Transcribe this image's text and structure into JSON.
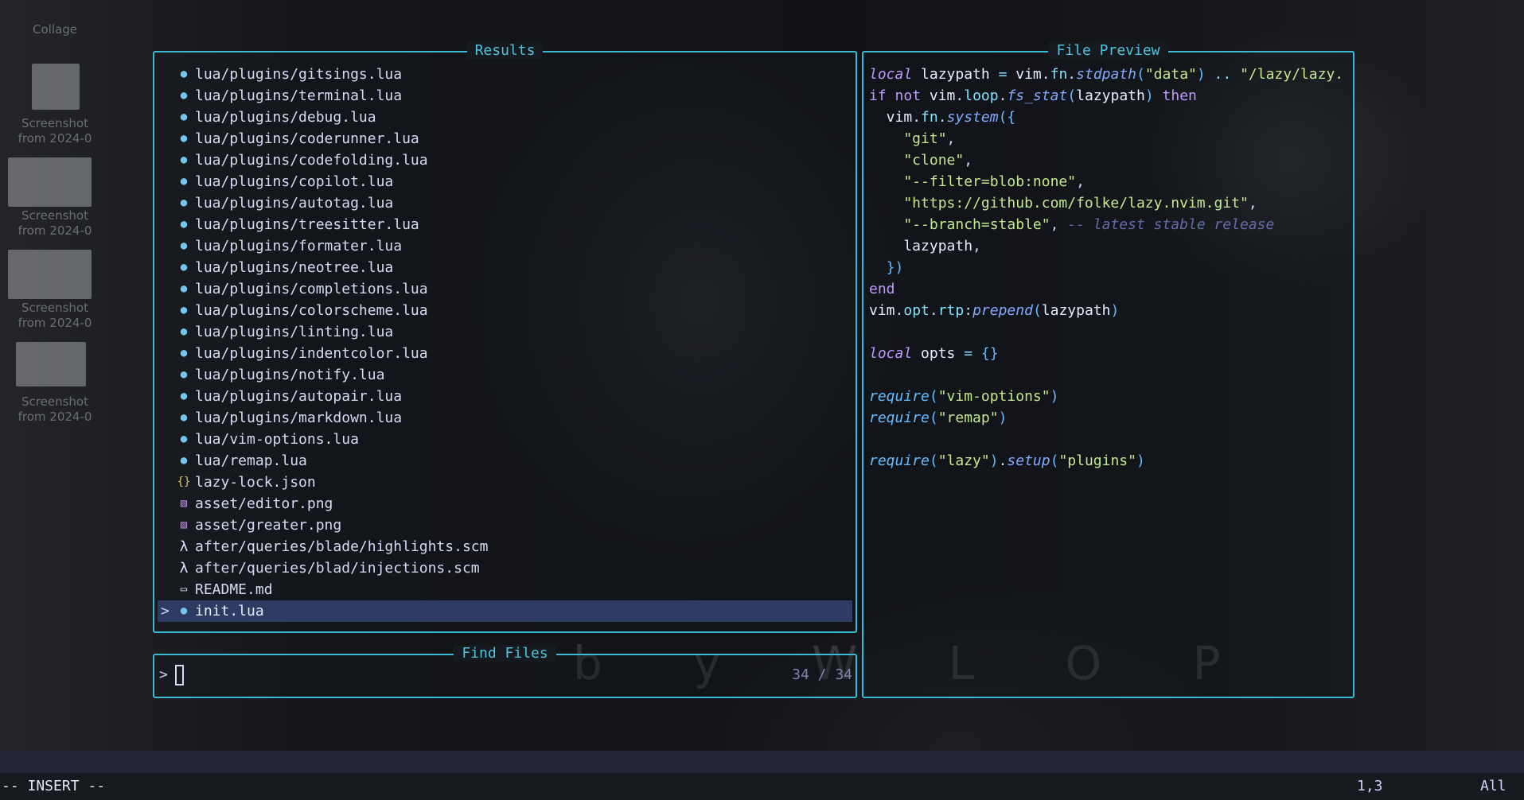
{
  "desktop": {
    "collage_label": "Collage",
    "screenshot_label_line1": "Screenshot",
    "screenshot_label_line2": "from 2024-0"
  },
  "results": {
    "title": "Results",
    "items": [
      {
        "icon": "lua-icon",
        "glyph": "●",
        "name": "lua/plugins/gitsings.lua"
      },
      {
        "icon": "lua-icon",
        "glyph": "●",
        "name": "lua/plugins/terminal.lua"
      },
      {
        "icon": "lua-icon",
        "glyph": "●",
        "name": "lua/plugins/debug.lua"
      },
      {
        "icon": "lua-icon",
        "glyph": "●",
        "name": "lua/plugins/coderunner.lua"
      },
      {
        "icon": "lua-icon",
        "glyph": "●",
        "name": "lua/plugins/codefolding.lua"
      },
      {
        "icon": "lua-icon",
        "glyph": "●",
        "name": "lua/plugins/copilot.lua"
      },
      {
        "icon": "lua-icon",
        "glyph": "●",
        "name": "lua/plugins/autotag.lua"
      },
      {
        "icon": "lua-icon",
        "glyph": "●",
        "name": "lua/plugins/treesitter.lua"
      },
      {
        "icon": "lua-icon",
        "glyph": "●",
        "name": "lua/plugins/formater.lua"
      },
      {
        "icon": "lua-icon",
        "glyph": "●",
        "name": "lua/plugins/neotree.lua"
      },
      {
        "icon": "lua-icon",
        "glyph": "●",
        "name": "lua/plugins/completions.lua"
      },
      {
        "icon": "lua-icon",
        "glyph": "●",
        "name": "lua/plugins/colorscheme.lua"
      },
      {
        "icon": "lua-icon",
        "glyph": "●",
        "name": "lua/plugins/linting.lua"
      },
      {
        "icon": "lua-icon",
        "glyph": "●",
        "name": "lua/plugins/indentcolor.lua"
      },
      {
        "icon": "lua-icon",
        "glyph": "●",
        "name": "lua/plugins/notify.lua"
      },
      {
        "icon": "lua-icon",
        "glyph": "●",
        "name": "lua/plugins/autopair.lua"
      },
      {
        "icon": "lua-icon",
        "glyph": "●",
        "name": "lua/plugins/markdown.lua"
      },
      {
        "icon": "lua-icon",
        "glyph": "●",
        "name": "lua/vim-options.lua"
      },
      {
        "icon": "lua-icon",
        "glyph": "●",
        "name": "lua/remap.lua"
      },
      {
        "icon": "json-icon",
        "glyph": "{}",
        "name": "lazy-lock.json"
      },
      {
        "icon": "image-icon",
        "glyph": "▨",
        "name": "asset/editor.png"
      },
      {
        "icon": "image-icon",
        "glyph": "▨",
        "name": "asset/greater.png"
      },
      {
        "icon": "lambda-icon",
        "glyph": "λ",
        "name": "after/queries/blade/highlights.scm"
      },
      {
        "icon": "lambda-icon",
        "glyph": "λ",
        "name": "after/queries/blad/injections.scm"
      },
      {
        "icon": "markdown-icon",
        "glyph": "▭",
        "name": "README.md"
      },
      {
        "icon": "lua-icon",
        "glyph": "●",
        "name": "init.lua",
        "selected": true
      }
    ],
    "selection_caret": ">"
  },
  "preview": {
    "title": "File Preview",
    "lines": [
      [
        [
          "kw",
          "local"
        ],
        [
          "var",
          " lazypath "
        ],
        [
          "op",
          "="
        ],
        [
          "var",
          " vim"
        ],
        [
          "pun",
          "."
        ],
        [
          "fld",
          "fn"
        ],
        [
          "pun",
          "."
        ],
        [
          "fnc",
          "stdpath"
        ],
        [
          "brk",
          "("
        ],
        [
          "str",
          "\"data\""
        ],
        [
          "brk",
          ")"
        ],
        [
          "op",
          " .."
        ],
        [
          "str",
          " \"/lazy/lazy."
        ]
      ],
      [
        [
          "kw2",
          "if"
        ],
        [
          "kw2",
          " not"
        ],
        [
          "var",
          " vim"
        ],
        [
          "pun",
          "."
        ],
        [
          "fld",
          "loop"
        ],
        [
          "pun",
          "."
        ],
        [
          "fnc",
          "fs_stat"
        ],
        [
          "brk",
          "("
        ],
        [
          "var",
          "lazypath"
        ],
        [
          "brk",
          ")"
        ],
        [
          "kw2",
          " then"
        ]
      ],
      [
        [
          "var",
          "  vim"
        ],
        [
          "pun",
          "."
        ],
        [
          "fld",
          "fn"
        ],
        [
          "pun",
          "."
        ],
        [
          "fnc",
          "system"
        ],
        [
          "brk",
          "({"
        ]
      ],
      [
        [
          "str",
          "    \"git\""
        ],
        [
          "pun",
          ","
        ]
      ],
      [
        [
          "str",
          "    \"clone\""
        ],
        [
          "pun",
          ","
        ]
      ],
      [
        [
          "str",
          "    \"--filter=blob:none\""
        ],
        [
          "pun",
          ","
        ]
      ],
      [
        [
          "str",
          "    \"https://github.com/folke/lazy.nvim.git\""
        ],
        [
          "pun",
          ","
        ]
      ],
      [
        [
          "str",
          "    \"--branch=stable\""
        ],
        [
          "pun",
          ","
        ],
        [
          "cm",
          " -- latest stable release"
        ]
      ],
      [
        [
          "var",
          "    lazypath"
        ],
        [
          "pun",
          ","
        ]
      ],
      [
        [
          "brk",
          "  })"
        ]
      ],
      [
        [
          "kw2",
          "end"
        ]
      ],
      [
        [
          "var",
          "vim"
        ],
        [
          "pun",
          "."
        ],
        [
          "fld",
          "opt"
        ],
        [
          "pun",
          "."
        ],
        [
          "fld",
          "rtp"
        ],
        [
          "pun",
          ":"
        ],
        [
          "fnc",
          "prepend"
        ],
        [
          "brk",
          "("
        ],
        [
          "var",
          "lazypath"
        ],
        [
          "brk",
          ")"
        ]
      ],
      [],
      [
        [
          "kw",
          "local"
        ],
        [
          "var",
          " opts "
        ],
        [
          "op",
          "="
        ],
        [
          "brk",
          " {}"
        ]
      ],
      [],
      [
        [
          "req",
          "require"
        ],
        [
          "brk",
          "("
        ],
        [
          "str",
          "\"vim-options\""
        ],
        [
          "brk",
          ")"
        ]
      ],
      [
        [
          "req",
          "require"
        ],
        [
          "brk",
          "("
        ],
        [
          "str",
          "\"remap\""
        ],
        [
          "brk",
          ")"
        ]
      ],
      [],
      [
        [
          "req",
          "require"
        ],
        [
          "brk",
          "("
        ],
        [
          "str",
          "\"lazy\""
        ],
        [
          "brk",
          ")"
        ],
        [
          "pun",
          "."
        ],
        [
          "fnc",
          "setup"
        ],
        [
          "brk",
          "("
        ],
        [
          "str",
          "\"plugins\""
        ],
        [
          "brk",
          ")"
        ]
      ]
    ]
  },
  "prompt": {
    "title": "Find Files",
    "caret": ">",
    "value": "",
    "count": "34 / 34"
  },
  "watermark": "b y W L O P",
  "statusline": {
    "mode": "-- INSERT --",
    "position": "1,3",
    "scroll": "All"
  },
  "colors": {
    "border": "#3ab8d6",
    "title": "#4fc3e0",
    "selection": "#2e3c64",
    "string": "#c3e88d",
    "keyword": "#c099ff",
    "function": "#82aaff"
  }
}
